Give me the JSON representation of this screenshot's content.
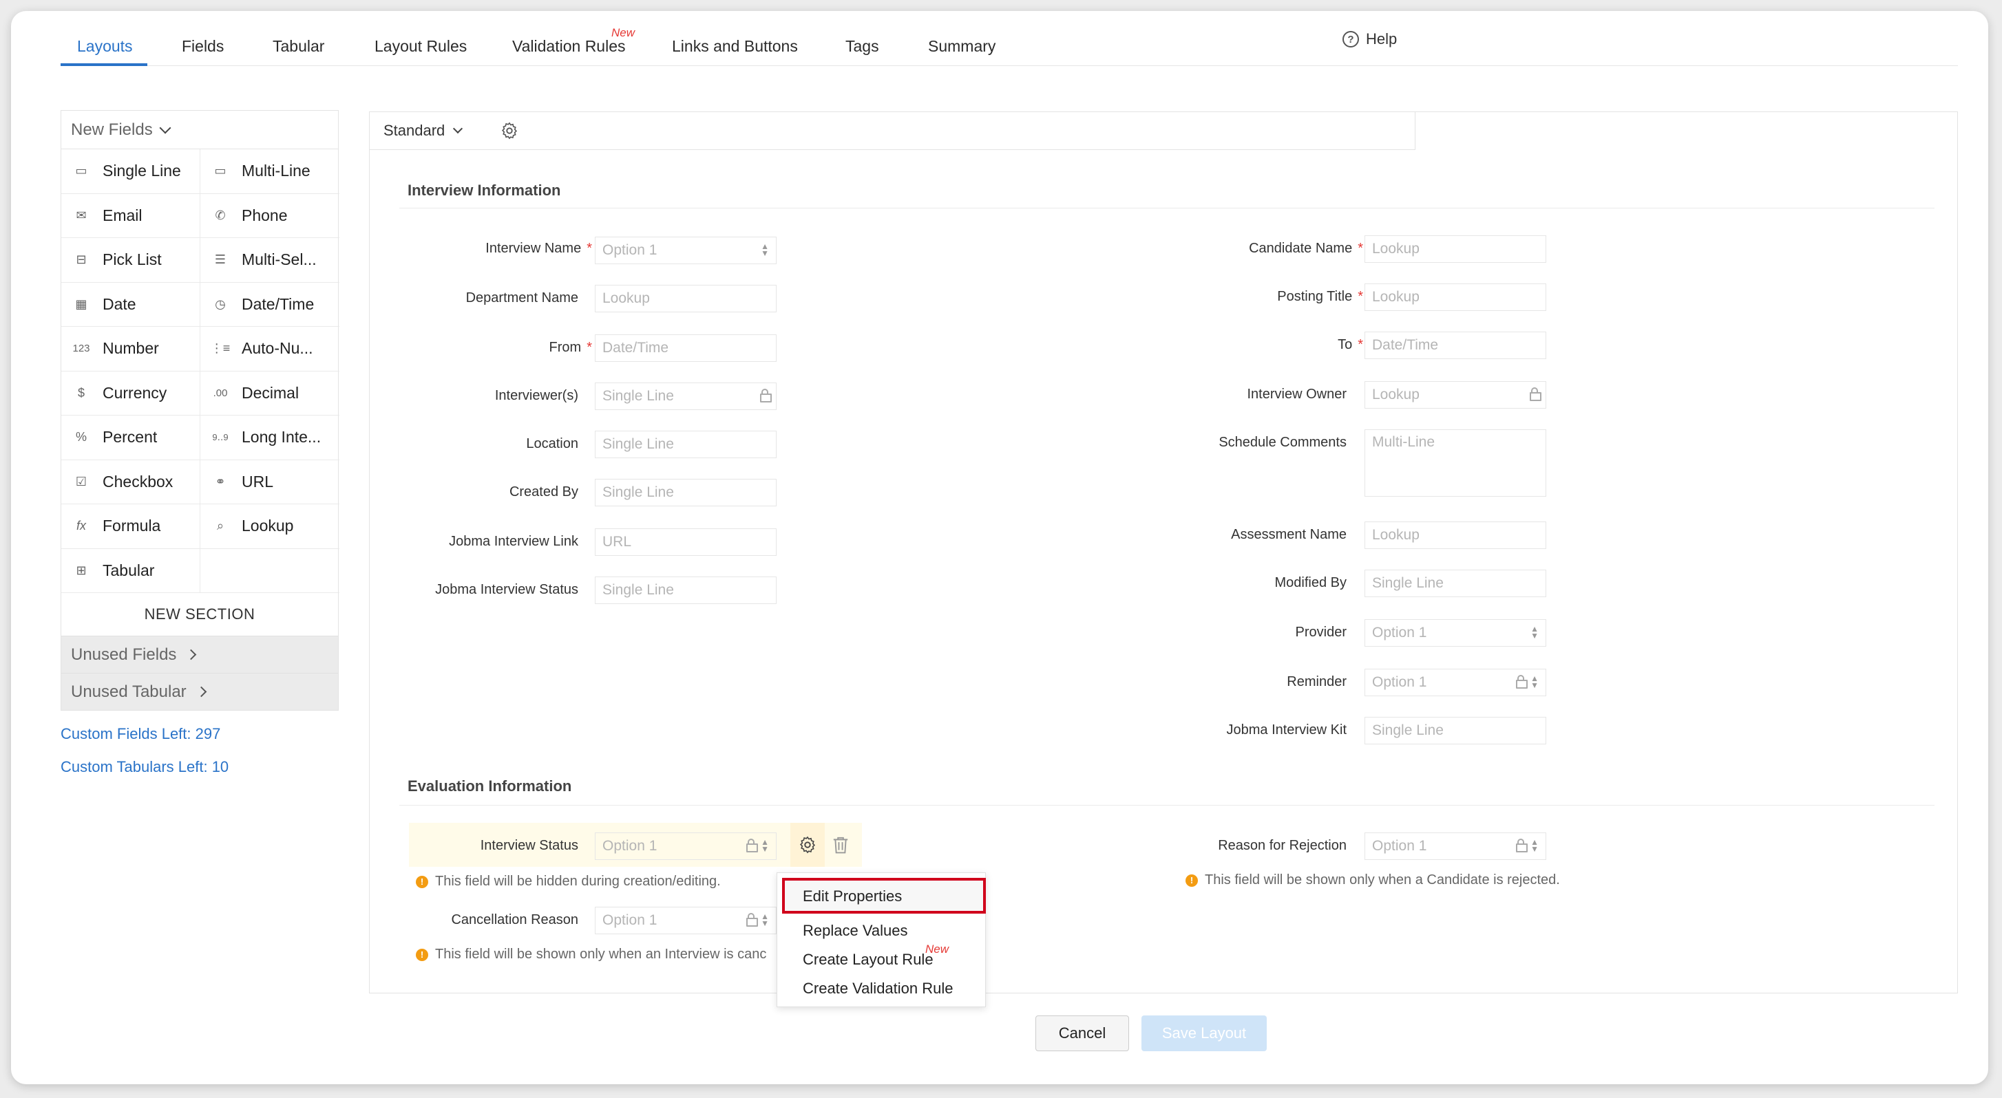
{
  "tabs": [
    {
      "label": "Layouts",
      "active": true
    },
    {
      "label": "Fields"
    },
    {
      "label": "Tabular"
    },
    {
      "label": "Layout Rules"
    },
    {
      "label": "Validation Rules",
      "badge": "New"
    },
    {
      "label": "Links and Buttons"
    },
    {
      "label": "Tags"
    },
    {
      "label": "Summary"
    }
  ],
  "help_label": "Help",
  "palette": {
    "header": "New Fields",
    "items": [
      {
        "label": "Single Line",
        "icon": "single-line-icon"
      },
      {
        "label": "Multi-Line",
        "icon": "multi-line-icon"
      },
      {
        "label": "Email",
        "icon": "email-icon"
      },
      {
        "label": "Phone",
        "icon": "phone-icon"
      },
      {
        "label": "Pick List",
        "icon": "pick-list-icon"
      },
      {
        "label": "Multi-Sel...",
        "icon": "multi-select-icon"
      },
      {
        "label": "Date",
        "icon": "date-icon"
      },
      {
        "label": "Date/Time",
        "icon": "date-time-icon"
      },
      {
        "label": "Number",
        "icon": "number-icon"
      },
      {
        "label": "Auto-Nu...",
        "icon": "auto-number-icon"
      },
      {
        "label": "Currency",
        "icon": "currency-icon"
      },
      {
        "label": "Decimal",
        "icon": "decimal-icon"
      },
      {
        "label": "Percent",
        "icon": "percent-icon"
      },
      {
        "label": "Long Inte...",
        "icon": "long-integer-icon"
      },
      {
        "label": "Checkbox",
        "icon": "checkbox-icon"
      },
      {
        "label": "URL",
        "icon": "url-icon"
      },
      {
        "label": "Formula",
        "icon": "formula-icon"
      },
      {
        "label": "Lookup",
        "icon": "lookup-icon"
      },
      {
        "label": "Tabular",
        "icon": "tabular-icon"
      }
    ],
    "new_section": "NEW SECTION",
    "unused_fields": "Unused Fields",
    "unused_tabular": "Unused Tabular"
  },
  "custom_fields_left": "Custom Fields Left: 297",
  "custom_tabulars_left": "Custom Tabulars Left: 10",
  "layout_select": "Standard",
  "interview_section": {
    "title": "Interview Information",
    "left": [
      {
        "label": "Interview Name",
        "required": "*",
        "placeholder": "Option 1"
      },
      {
        "label": "Department Name",
        "placeholder": "Lookup"
      },
      {
        "label": "From",
        "required": "*",
        "placeholder": "Date/Time"
      },
      {
        "label": "Interviewer(s)",
        "placeholder": "Single Line"
      },
      {
        "label": "Location",
        "placeholder": "Single Line"
      },
      {
        "label": "Created By",
        "placeholder": "Single Line"
      },
      {
        "label": "Jobma Interview Link",
        "placeholder": "URL"
      },
      {
        "label": "Jobma Interview Status",
        "placeholder": "Single Line"
      }
    ],
    "right": [
      {
        "label": "Candidate Name",
        "required": "*",
        "placeholder": "Lookup"
      },
      {
        "label": "Posting Title",
        "required": "*",
        "placeholder": "Lookup"
      },
      {
        "label": "To",
        "required": "*",
        "placeholder": "Date/Time"
      },
      {
        "label": "Interview Owner",
        "placeholder": "Lookup"
      },
      {
        "label": "Schedule Comments",
        "placeholder": "Multi-Line"
      },
      {
        "label": "Assessment Name",
        "placeholder": "Lookup"
      },
      {
        "label": "Modified By",
        "placeholder": "Single Line"
      },
      {
        "label": "Provider",
        "placeholder": "Option 1"
      },
      {
        "label": "Reminder",
        "placeholder": "Option 1"
      },
      {
        "label": "Jobma Interview Kit",
        "placeholder": "Single Line"
      }
    ]
  },
  "evaluation_section": {
    "title": "Evaluation Information",
    "interview_status": {
      "label": "Interview Status",
      "placeholder": "Option 1",
      "note": "This field will be hidden during creation/editing."
    },
    "cancellation_reason": {
      "label": "Cancellation Reason",
      "placeholder": "Option 1",
      "note": "This field will be shown only when an Interview is canc"
    },
    "reason_for_rejection": {
      "label": "Reason for Rejection",
      "placeholder": "Option 1",
      "note": "This field will be shown only when a Candidate is rejected."
    }
  },
  "context_menu": {
    "items": [
      "Edit Properties",
      "Replace Values",
      "Create Layout Rule",
      "Create Validation Rule"
    ],
    "layout_rule_badge": "New"
  },
  "buttons": {
    "cancel": "Cancel",
    "save": "Save Layout"
  },
  "colors": {
    "accent": "#2a73c8",
    "required": "#e53935",
    "highlight_border": "#d0021b",
    "info": "#f39c12"
  }
}
